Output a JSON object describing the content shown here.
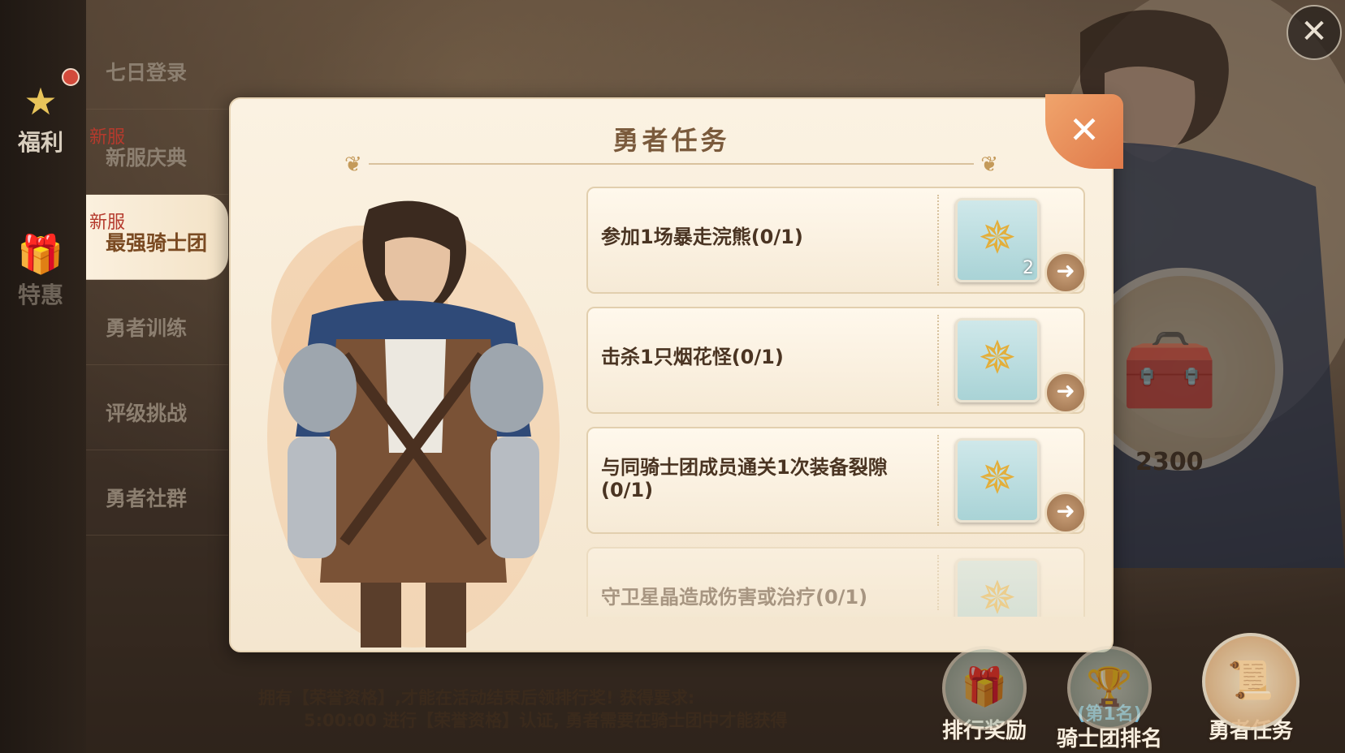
{
  "top_close_label": "✕",
  "rail": {
    "welfare_label": "福利",
    "deals_label": "特惠"
  },
  "menu": {
    "items": [
      {
        "label": "七日登录",
        "tag": ""
      },
      {
        "label": "新服庆典",
        "tag": "新服"
      },
      {
        "label": "最强骑士团",
        "tag": "新服"
      },
      {
        "label": "勇者训练",
        "tag": ""
      },
      {
        "label": "评级挑战",
        "tag": ""
      },
      {
        "label": "勇者社群",
        "tag": ""
      }
    ]
  },
  "dialog": {
    "title": "勇者任务",
    "close_label": "✕",
    "tasks": [
      {
        "text": "参加1场暴走浣熊(0/1)",
        "reward_count": "2"
      },
      {
        "text": "击杀1只烟花怪(0/1)",
        "reward_count": ""
      },
      {
        "text": "与同骑士团成员通关1次装备裂隙(0/1)",
        "reward_count": ""
      },
      {
        "text": "守卫星晶造成伤害或治疗(0/1)",
        "reward_count": ""
      }
    ],
    "go_label": "➜"
  },
  "right_panel": {
    "chest_value": "2300"
  },
  "notice": {
    "line1": "拥有【荣誉资格】,才能在活动结束后领排行奖! 获得要求:",
    "line2": "5:00:00 进行【荣誉资格】认证, 勇者需要在骑士团中才能获得"
  },
  "bottom_buttons": {
    "rank_reward_label": "排行奖励",
    "guild_rank_sub": "(第1名)",
    "guild_rank_label": "骑士团排名",
    "hero_task_label": "勇者任务"
  },
  "icons": {
    "welfare": "star-icon",
    "deals": "gift-icon",
    "reward": "emblem-icon",
    "chest": "treasure-chest-icon",
    "trophy": "trophy-icon",
    "scroll": "scroll-icon"
  },
  "colors": {
    "accent": "#e07a4a",
    "title": "#7a5a3c",
    "new_tag": "#b53a2d",
    "rank_sub": "#6db7d8"
  }
}
